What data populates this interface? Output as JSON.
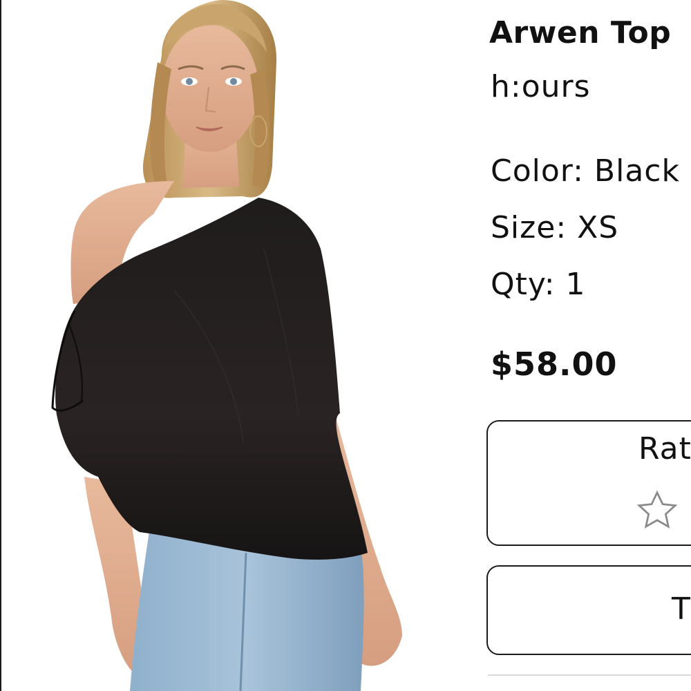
{
  "product": {
    "name": "Arwen Top",
    "brand": "h:ours",
    "color_label": "Color: Black",
    "size_label": "Size: XS",
    "qty_label": "Qty: 1",
    "price": "$58.00"
  },
  "rating": {
    "label": "Rate",
    "star_icon": "star-outline-icon"
  },
  "action": {
    "label": "T"
  },
  "colors": {
    "text": "#111111",
    "border": "#1a1a1a",
    "star_outline": "#8a8a8a",
    "divider": "#d7d7d7"
  }
}
